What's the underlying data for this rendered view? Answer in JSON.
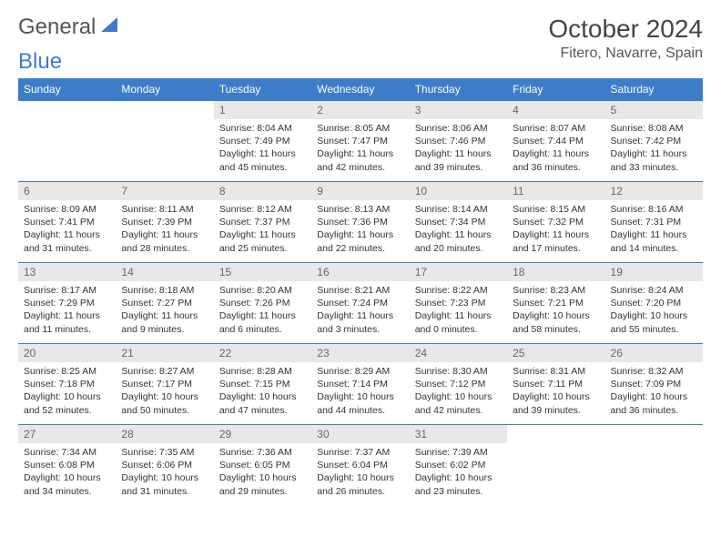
{
  "logo": {
    "part1": "General",
    "part2": "Blue"
  },
  "title": "October 2024",
  "location": "Fitero, Navarre, Spain",
  "weekdays": [
    "Sunday",
    "Monday",
    "Tuesday",
    "Wednesday",
    "Thursday",
    "Friday",
    "Saturday"
  ],
  "weeks": [
    [
      null,
      null,
      {
        "n": "1",
        "sr": "8:04 AM",
        "ss": "7:49 PM",
        "dl": "11 hours and 45 minutes."
      },
      {
        "n": "2",
        "sr": "8:05 AM",
        "ss": "7:47 PM",
        "dl": "11 hours and 42 minutes."
      },
      {
        "n": "3",
        "sr": "8:06 AM",
        "ss": "7:46 PM",
        "dl": "11 hours and 39 minutes."
      },
      {
        "n": "4",
        "sr": "8:07 AM",
        "ss": "7:44 PM",
        "dl": "11 hours and 36 minutes."
      },
      {
        "n": "5",
        "sr": "8:08 AM",
        "ss": "7:42 PM",
        "dl": "11 hours and 33 minutes."
      }
    ],
    [
      {
        "n": "6",
        "sr": "8:09 AM",
        "ss": "7:41 PM",
        "dl": "11 hours and 31 minutes."
      },
      {
        "n": "7",
        "sr": "8:11 AM",
        "ss": "7:39 PM",
        "dl": "11 hours and 28 minutes."
      },
      {
        "n": "8",
        "sr": "8:12 AM",
        "ss": "7:37 PM",
        "dl": "11 hours and 25 minutes."
      },
      {
        "n": "9",
        "sr": "8:13 AM",
        "ss": "7:36 PM",
        "dl": "11 hours and 22 minutes."
      },
      {
        "n": "10",
        "sr": "8:14 AM",
        "ss": "7:34 PM",
        "dl": "11 hours and 20 minutes."
      },
      {
        "n": "11",
        "sr": "8:15 AM",
        "ss": "7:32 PM",
        "dl": "11 hours and 17 minutes."
      },
      {
        "n": "12",
        "sr": "8:16 AM",
        "ss": "7:31 PM",
        "dl": "11 hours and 14 minutes."
      }
    ],
    [
      {
        "n": "13",
        "sr": "8:17 AM",
        "ss": "7:29 PM",
        "dl": "11 hours and 11 minutes."
      },
      {
        "n": "14",
        "sr": "8:18 AM",
        "ss": "7:27 PM",
        "dl": "11 hours and 9 minutes."
      },
      {
        "n": "15",
        "sr": "8:20 AM",
        "ss": "7:26 PM",
        "dl": "11 hours and 6 minutes."
      },
      {
        "n": "16",
        "sr": "8:21 AM",
        "ss": "7:24 PM",
        "dl": "11 hours and 3 minutes."
      },
      {
        "n": "17",
        "sr": "8:22 AM",
        "ss": "7:23 PM",
        "dl": "11 hours and 0 minutes."
      },
      {
        "n": "18",
        "sr": "8:23 AM",
        "ss": "7:21 PM",
        "dl": "10 hours and 58 minutes."
      },
      {
        "n": "19",
        "sr": "8:24 AM",
        "ss": "7:20 PM",
        "dl": "10 hours and 55 minutes."
      }
    ],
    [
      {
        "n": "20",
        "sr": "8:25 AM",
        "ss": "7:18 PM",
        "dl": "10 hours and 52 minutes."
      },
      {
        "n": "21",
        "sr": "8:27 AM",
        "ss": "7:17 PM",
        "dl": "10 hours and 50 minutes."
      },
      {
        "n": "22",
        "sr": "8:28 AM",
        "ss": "7:15 PM",
        "dl": "10 hours and 47 minutes."
      },
      {
        "n": "23",
        "sr": "8:29 AM",
        "ss": "7:14 PM",
        "dl": "10 hours and 44 minutes."
      },
      {
        "n": "24",
        "sr": "8:30 AM",
        "ss": "7:12 PM",
        "dl": "10 hours and 42 minutes."
      },
      {
        "n": "25",
        "sr": "8:31 AM",
        "ss": "7:11 PM",
        "dl": "10 hours and 39 minutes."
      },
      {
        "n": "26",
        "sr": "8:32 AM",
        "ss": "7:09 PM",
        "dl": "10 hours and 36 minutes."
      }
    ],
    [
      {
        "n": "27",
        "sr": "7:34 AM",
        "ss": "6:08 PM",
        "dl": "10 hours and 34 minutes."
      },
      {
        "n": "28",
        "sr": "7:35 AM",
        "ss": "6:06 PM",
        "dl": "10 hours and 31 minutes."
      },
      {
        "n": "29",
        "sr": "7:36 AM",
        "ss": "6:05 PM",
        "dl": "10 hours and 29 minutes."
      },
      {
        "n": "30",
        "sr": "7:37 AM",
        "ss": "6:04 PM",
        "dl": "10 hours and 26 minutes."
      },
      {
        "n": "31",
        "sr": "7:39 AM",
        "ss": "6:02 PM",
        "dl": "10 hours and 23 minutes."
      },
      null,
      null
    ]
  ],
  "labels": {
    "sunrise": "Sunrise: ",
    "sunset": "Sunset: ",
    "daylight": "Daylight: "
  }
}
